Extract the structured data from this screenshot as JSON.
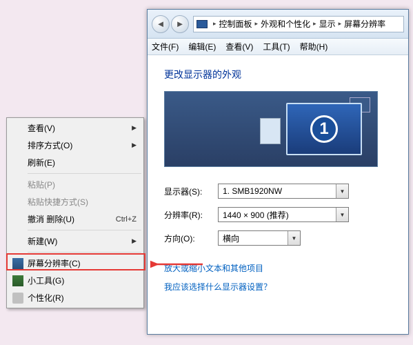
{
  "context_menu": {
    "view": "查看(V)",
    "sort": "排序方式(O)",
    "refresh": "刷新(E)",
    "paste": "粘贴(P)",
    "paste_shortcut": "粘贴快捷方式(S)",
    "undo_delete": "撤消 删除(U)",
    "undo_key": "Ctrl+Z",
    "new": "新建(W)",
    "screen_res": "屏幕分辨率(C)",
    "gadgets": "小工具(G)",
    "personalize": "个性化(R)"
  },
  "window": {
    "breadcrumb": [
      "控制面板",
      "外观和个性化",
      "显示",
      "屏幕分辨率"
    ],
    "menubar": [
      "文件(F)",
      "编辑(E)",
      "查看(V)",
      "工具(T)",
      "帮助(H)"
    ],
    "heading": "更改显示器的外观",
    "monitor_number": "1",
    "labels": {
      "display": "显示器(S):",
      "resolution": "分辨率(R):",
      "orientation": "方向(O):"
    },
    "values": {
      "display": "1. SMB1920NW",
      "resolution": "1440 × 900 (推荐)",
      "orientation": "横向"
    },
    "links": {
      "text_size": "放大或缩小文本和其他项目",
      "which": "我应该选择什么显示器设置？"
    }
  }
}
